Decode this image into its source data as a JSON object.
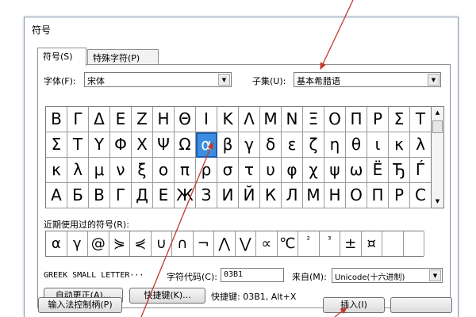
{
  "dialog": {
    "title": "符号"
  },
  "tabs": [
    {
      "label": "符号(S)"
    },
    {
      "label": "特殊字符(P)"
    }
  ],
  "font": {
    "label": "字体(F):",
    "value": "宋体"
  },
  "subset": {
    "label": "子集(U):",
    "value": "基本希腊语"
  },
  "symbol_grid": {
    "rows": [
      [
        "Β",
        "Γ",
        "Δ",
        "Ε",
        "Ζ",
        "Η",
        "Θ",
        "Ι",
        "Κ",
        "Λ",
        "Μ",
        "Ν",
        "Ξ",
        "Ο",
        "Π",
        "Ρ",
        "Σ",
        "Τ"
      ],
      [
        "Σ",
        "Τ",
        "Υ",
        "Φ",
        "Χ",
        "Ψ",
        "Ω",
        "α",
        "β",
        "γ",
        "δ",
        "ε",
        "ζ",
        "η",
        "θ",
        "ι",
        "κ",
        "λ"
      ],
      [
        "κ",
        "λ",
        "μ",
        "ν",
        "ξ",
        "ο",
        "π",
        "ρ",
        "σ",
        "τ",
        "υ",
        "φ",
        "χ",
        "ψ",
        "ω",
        "Ё",
        "Ђ",
        "Ѓ"
      ],
      [
        "А",
        "Б",
        "В",
        "Г",
        "Д",
        "Е",
        "Ж",
        "З",
        "И",
        "Й",
        "К",
        "Л",
        "М",
        "Н",
        "О",
        "П",
        "Р",
        "С"
      ]
    ],
    "selected_row": 1,
    "selected_col": 7
  },
  "recent": {
    "label": "近期使用过的符号(R):",
    "symbols": [
      "α",
      "γ",
      "@",
      "⋟",
      "⋞",
      "∪",
      "∩",
      "¬",
      "⋀",
      "⋁",
      "∝",
      "℃",
      "²",
      "³",
      "±",
      "¤",
      "",
      ""
    ]
  },
  "char_name": "GREEK SMALL LETTER···",
  "char_code": {
    "label": "字符代码(C):",
    "value": "03B1"
  },
  "from": {
    "label": "来自(M):",
    "value": "Unicode(十六进制)"
  },
  "buttons": {
    "autocorrect": "自动更正(A)...",
    "shortcut_key": "快捷键(K)...",
    "ime": "输入法控制柄(P)",
    "insert": "插入(I)"
  },
  "shortcut_text": "快捷键: 03B1, Alt+X",
  "annotation_color": "#c0392b"
}
